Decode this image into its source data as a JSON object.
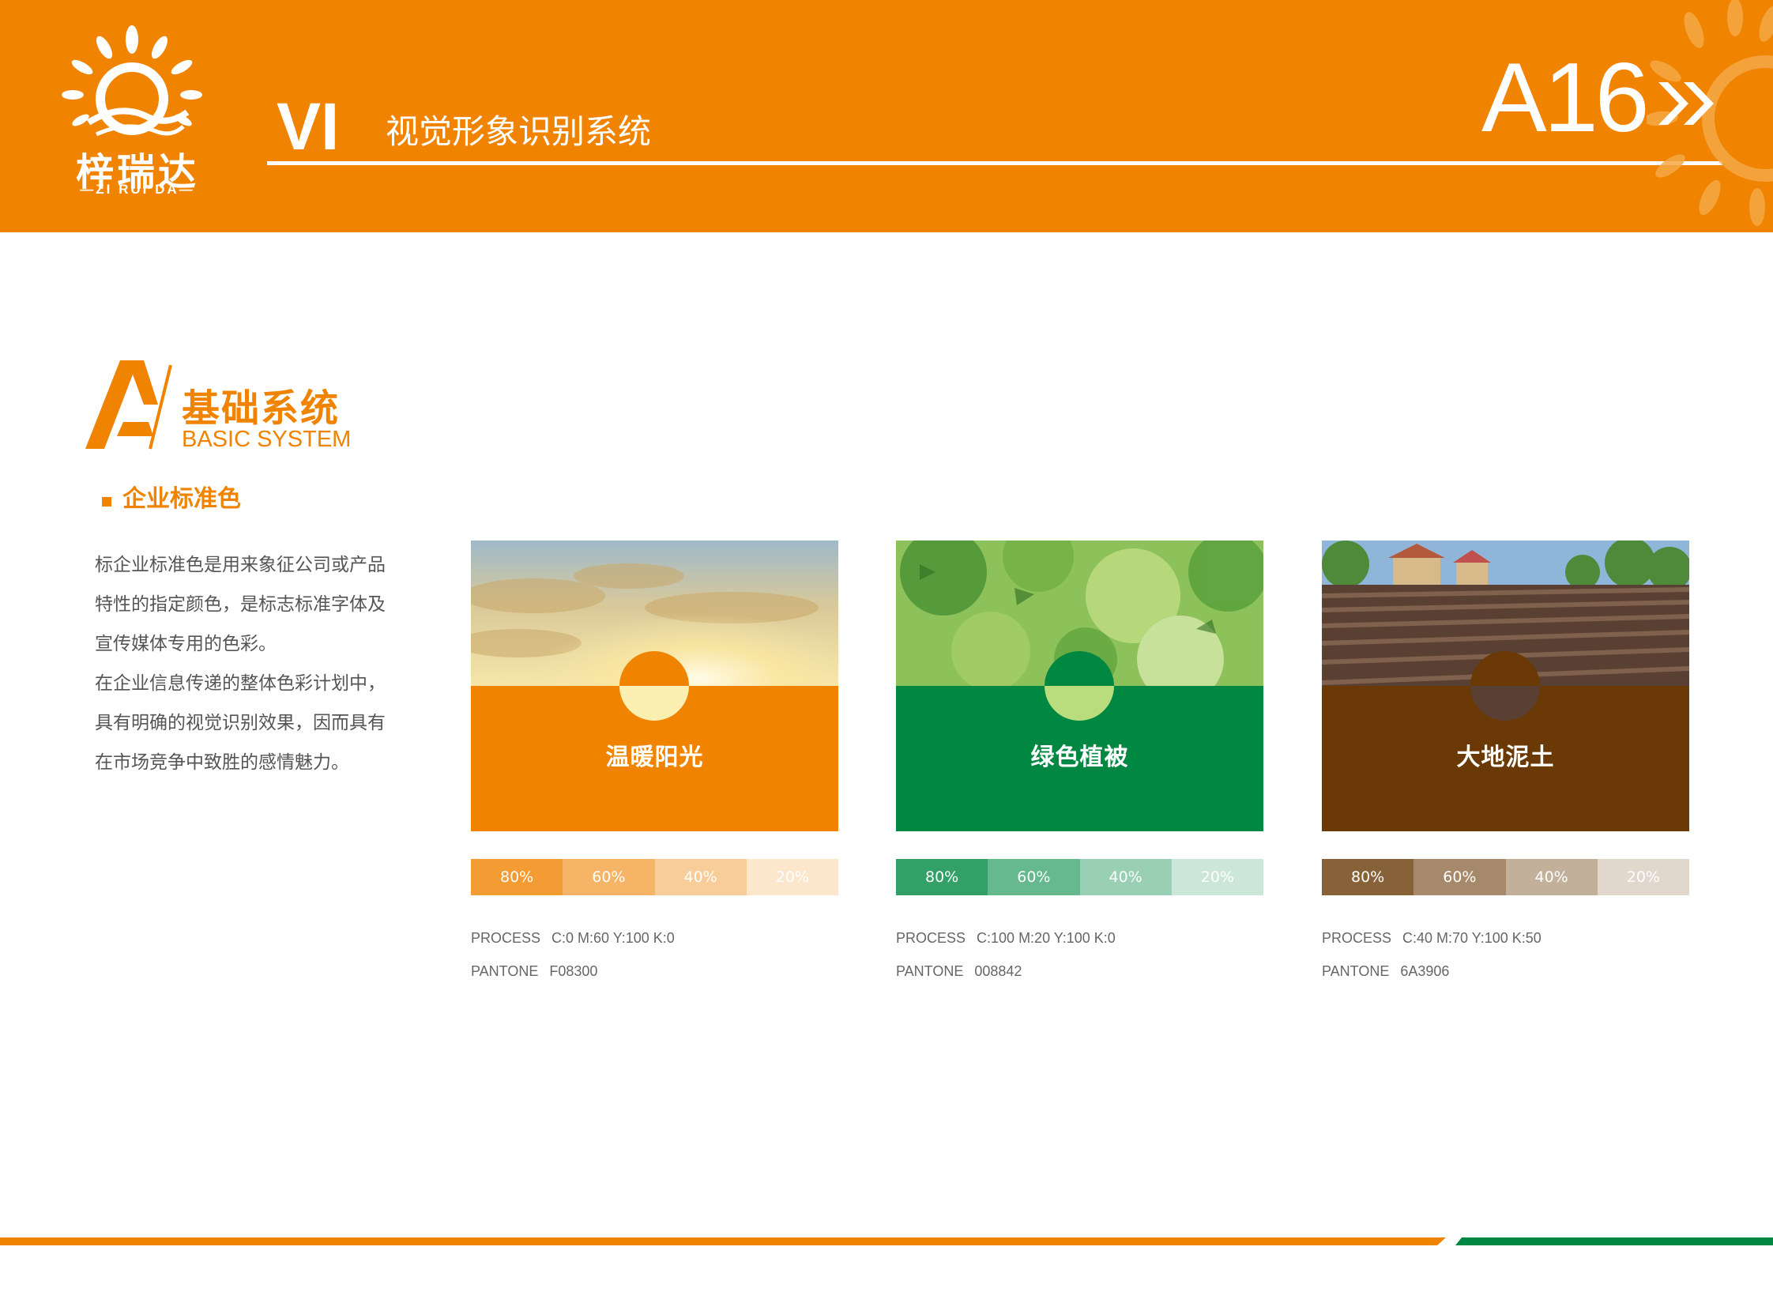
{
  "colors": {
    "orange": "#F08300",
    "green": "#008842",
    "brown": "#6A3906",
    "white": "#FFFFFF",
    "text_gray": "#555555"
  },
  "header": {
    "logo_cn": "梓瑞达",
    "logo_en": "—ZI RUI DA—",
    "vi_label": "VI",
    "subtitle": "视觉形象识别系统",
    "page_number": "A16",
    "chevron_icon": "double-chevron-right-icon"
  },
  "section": {
    "letter": "A",
    "title_cn": "基础系统",
    "title_en": "BASIC SYSTEM",
    "sub_heading": "企业标准色"
  },
  "description": {
    "lines": [
      "标企业标准色是用来象征公司或产品",
      "特性的指定颜色，是标志标准字体及",
      "宣传媒体专用的色彩。",
      "在企业信息传递的整体色彩计划中，",
      "具有明确的视觉识别效果，因而具有",
      "在市场竞争中致胜的感情魅力。"
    ]
  },
  "swatches": [
    {
      "name": "温暖阳光",
      "color": "#F08300",
      "photo": "sunset-sky",
      "tints": [
        {
          "label": "80%",
          "color": "#F39C33"
        },
        {
          "label": "60%",
          "color": "#F6B466"
        },
        {
          "label": "40%",
          "color": "#F9CD99"
        },
        {
          "label": "20%",
          "color": "#FCE6CC"
        }
      ],
      "process_label": "PROCESS",
      "process_value": "C:0  M:60 Y:100  K:0",
      "pantone_label": "PANTONE",
      "pantone_value": "F08300"
    },
    {
      "name": "绿色植被",
      "color": "#008842",
      "photo": "green-leaves",
      "tints": [
        {
          "label": "80%",
          "color": "#33A068"
        },
        {
          "label": "60%",
          "color": "#66B88E"
        },
        {
          "label": "40%",
          "color": "#99CFB3"
        },
        {
          "label": "20%",
          "color": "#CCE7D9"
        }
      ],
      "process_label": "PROCESS",
      "process_value": "C:100  M:20  Y:100 K:0",
      "pantone_label": "PANTONE",
      "pantone_value": "008842"
    },
    {
      "name": "大地泥土",
      "color": "#6A3906",
      "photo": "plowed-field",
      "tints": [
        {
          "label": "80%",
          "color": "#876138"
        },
        {
          "label": "60%",
          "color": "#A6886A"
        },
        {
          "label": "40%",
          "color": "#C3B09B"
        },
        {
          "label": "20%",
          "color": "#E1D7CD"
        }
      ],
      "process_label": "PROCESS",
      "process_value": "C:40  M:70  Y:100  K:50",
      "pantone_label": "PANTONE",
      "pantone_value": "6A3906"
    }
  ]
}
